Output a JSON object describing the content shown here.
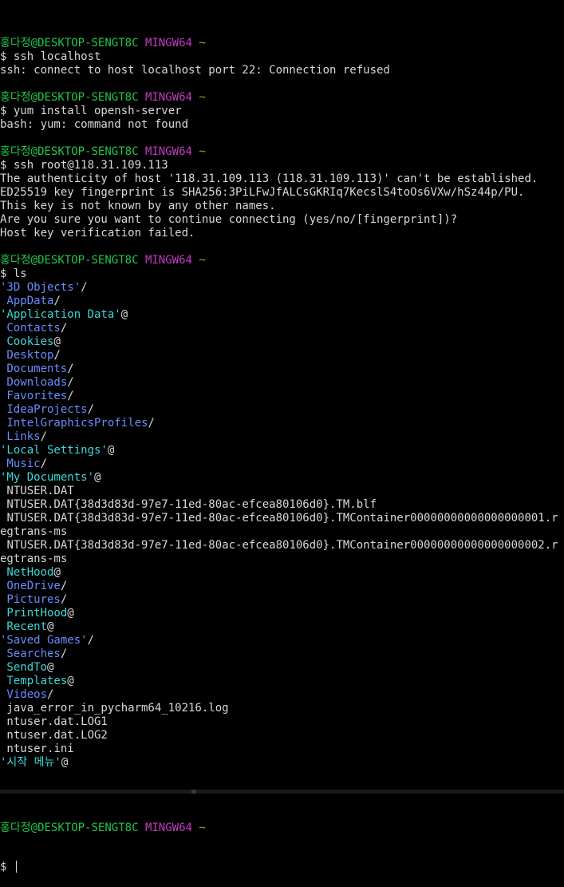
{
  "prompt": {
    "user": "홍다정@DESKTOP-SENGT8C",
    "system": "MINGW64",
    "path": "~",
    "symbol": "$ "
  },
  "blocks": [
    {
      "command": "ssh localhost",
      "output": [
        {
          "text": "ssh: connect to host localhost port 22: Connection refused",
          "kind": "text"
        }
      ]
    },
    {
      "command": "yum install opensh-server",
      "output": [
        {
          "text": "bash: yum: command not found",
          "kind": "text"
        }
      ]
    },
    {
      "command": "ssh root@118.31.109.113",
      "output": [
        {
          "text": "The authenticity of host '118.31.109.113 (118.31.109.113)' can't be established.",
          "kind": "text"
        },
        {
          "text": "ED25519 key fingerprint is SHA256:3PiLFwJfALCsGKRIq7KecslS4toOs6VXw/hSz44p/PU.",
          "kind": "text"
        },
        {
          "text": "This key is not known by any other names.",
          "kind": "text"
        },
        {
          "text": "Are you sure you want to continue connecting (yes/no/[fingerprint])?",
          "kind": "text"
        },
        {
          "text": "Host key verification failed.",
          "kind": "text"
        }
      ]
    },
    {
      "command": "ls",
      "output": [
        {
          "text": "'3D Objects'",
          "suffix": "/",
          "kind": "dir"
        },
        {
          "text": " AppData",
          "suffix": "/",
          "kind": "dir"
        },
        {
          "text": "'Application Data'",
          "suffix": "@",
          "kind": "link"
        },
        {
          "text": " Contacts",
          "suffix": "/",
          "kind": "dir"
        },
        {
          "text": " Cookies",
          "suffix": "@",
          "kind": "link"
        },
        {
          "text": " Desktop",
          "suffix": "/",
          "kind": "dir"
        },
        {
          "text": " Documents",
          "suffix": "/",
          "kind": "dir"
        },
        {
          "text": " Downloads",
          "suffix": "/",
          "kind": "dir"
        },
        {
          "text": " Favorites",
          "suffix": "/",
          "kind": "dir"
        },
        {
          "text": " IdeaProjects",
          "suffix": "/",
          "kind": "dir"
        },
        {
          "text": " IntelGraphicsProfiles",
          "suffix": "/",
          "kind": "dir"
        },
        {
          "text": " Links",
          "suffix": "/",
          "kind": "dir"
        },
        {
          "text": "'Local Settings'",
          "suffix": "@",
          "kind": "link"
        },
        {
          "text": " Music",
          "suffix": "/",
          "kind": "dir"
        },
        {
          "text": "'My Documents'",
          "suffix": "@",
          "kind": "link"
        },
        {
          "text": " NTUSER.DAT",
          "suffix": "",
          "kind": "file"
        },
        {
          "text": " NTUSER.DAT{38d3d83d-97e7-11ed-80ac-efcea80106d0}.TM.blf",
          "suffix": "",
          "kind": "file"
        },
        {
          "text": " NTUSER.DAT{38d3d83d-97e7-11ed-80ac-efcea80106d0}.TMContainer00000000000000000001.regtrans-ms",
          "suffix": "",
          "kind": "file"
        },
        {
          "text": " NTUSER.DAT{38d3d83d-97e7-11ed-80ac-efcea80106d0}.TMContainer00000000000000000002.regtrans-ms",
          "suffix": "",
          "kind": "file"
        },
        {
          "text": " NetHood",
          "suffix": "@",
          "kind": "link"
        },
        {
          "text": " OneDrive",
          "suffix": "/",
          "kind": "dir"
        },
        {
          "text": " Pictures",
          "suffix": "/",
          "kind": "dir"
        },
        {
          "text": " PrintHood",
          "suffix": "@",
          "kind": "link"
        },
        {
          "text": " Recent",
          "suffix": "@",
          "kind": "link"
        },
        {
          "text": "'Saved Games'",
          "suffix": "/",
          "kind": "dir"
        },
        {
          "text": " Searches",
          "suffix": "/",
          "kind": "dir"
        },
        {
          "text": " SendTo",
          "suffix": "@",
          "kind": "link"
        },
        {
          "text": " Templates",
          "suffix": "@",
          "kind": "link"
        },
        {
          "text": " Videos",
          "suffix": "/",
          "kind": "dir"
        },
        {
          "text": " java_error_in_pycharm64_10216.log",
          "suffix": "",
          "kind": "file"
        },
        {
          "text": " ntuser.dat.LOG1",
          "suffix": "",
          "kind": "file"
        },
        {
          "text": " ntuser.dat.LOG2",
          "suffix": "",
          "kind": "file"
        },
        {
          "text": " ntuser.ini",
          "suffix": "",
          "kind": "file"
        },
        {
          "text": "'시작 메뉴'",
          "suffix": "@",
          "kind": "link"
        }
      ]
    }
  ],
  "current_command": "",
  "colors": {
    "background": "#000000",
    "text": "#d8d8d8",
    "prompt_user": "#1fc64a",
    "prompt_system": "#c23bc2",
    "prompt_path": "#c0a000",
    "directory": "#6a8cff",
    "symlink": "#3cd8d8"
  }
}
